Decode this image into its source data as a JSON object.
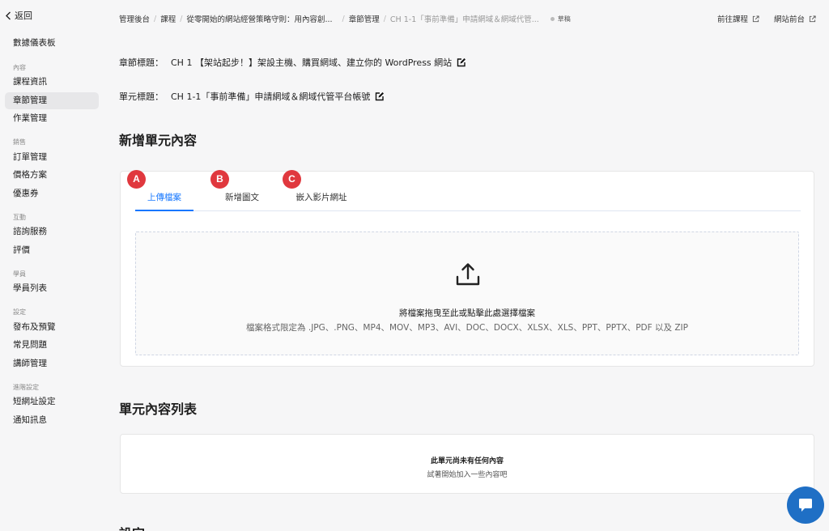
{
  "sidebar": {
    "back_label": "返回",
    "dashboard": "數據儀表板",
    "section_content": "內容",
    "course_info": "課程資訊",
    "chapter_mgmt": "章節管理",
    "homework_mgmt": "作業管理",
    "section_sales": "銷售",
    "order_mgmt": "訂單管理",
    "pricing": "價格方案",
    "coupons": "優惠券",
    "section_interaction": "互動",
    "consulting": "諮詢服務",
    "reviews": "評價",
    "section_students": "學員",
    "student_list": "學員列表",
    "section_settings": "設定",
    "publish": "發布及預覽",
    "faq": "常見問題",
    "instructor_mgmt": "講師管理",
    "section_advanced": "進階設定",
    "short_url": "短網址設定",
    "notifications": "通知訊息"
  },
  "breadcrumb": {
    "item1": "管理後台",
    "item2": "課程",
    "item3": "從零開始的網站經營策略守則：用內容創...",
    "item4": "章節管理",
    "item5": "CH 1-1「事前準備」申請網域＆網域代管...",
    "status": "草稿"
  },
  "top_links": {
    "go_course": "前往課程",
    "site_front": "網站前台"
  },
  "chapter": {
    "label": "章節標題：",
    "title": "CH 1 【架站起步！】架設主機、購買網域、建立你的 WordPress 網站"
  },
  "unit": {
    "label": "單元標題：",
    "title": "CH 1-1「事前準備」申請網域＆網域代管平台帳號"
  },
  "add_section": {
    "heading": "新增單元內容",
    "tabs": [
      "上傳檔案",
      "新增圖文",
      "嵌入影片網址"
    ],
    "markers": [
      "A",
      "B",
      "C"
    ],
    "drop_title": "將檔案拖曳至此或點擊此處選擇檔案",
    "drop_hint": "檔案格式限定為 .JPG、.PNG、MP4、MOV、MP3、AVI、DOC、DOCX、XLSX、XLS、PPT、PPTX、PDF 以及 ZIP"
  },
  "list_section": {
    "heading": "單元內容列表",
    "empty_title": "此單元尚未有任何內容",
    "empty_sub": "試著開始加入一些內容吧"
  },
  "settings_section": {
    "heading": "設定"
  },
  "colors": {
    "accent": "#1677ff",
    "marker": "#e0383e",
    "chat": "#1f6fc5"
  }
}
